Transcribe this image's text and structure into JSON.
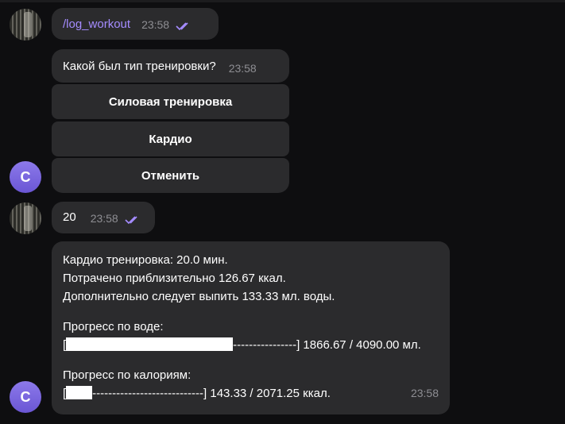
{
  "messages": {
    "m1": {
      "text": "/log_workout",
      "time": "23:58"
    },
    "m2": {
      "text": "Какой был тип тренировки?",
      "time": "23:58"
    },
    "keyboard": {
      "b1": "Силовая тренировка",
      "b2": "Кардио",
      "b3": "Отменить"
    },
    "m3": {
      "text": "20",
      "time": "23:58"
    },
    "m4": {
      "line1": "Кардио тренировка: 20.0 мин.",
      "line2": "Потрачено приблизительно 126.67 ккал.",
      "line3": "Дополнительно следует выпить 133.33 мл. воды.",
      "water_title": "Прогресс по воде:",
      "water_open": "[",
      "water_dashes": "----------------]",
      "water_value": " 1866.67 / 4090.00 мл.",
      "cal_title": "Прогресс по калориям:",
      "cal_open": "[",
      "cal_dashes": "----------------------------]",
      "cal_value": " 143.33 / 2071.25 ккал.",
      "time": "23:58"
    }
  },
  "avatars": {
    "bot_letter": "C"
  },
  "colors": {
    "background": "#0e0e10",
    "bubble": "#2b2b2d",
    "accent": "#a58cff",
    "avatar": "#7a66e0"
  },
  "progress": {
    "water_fraction": 0.456,
    "calorie_fraction": 0.069
  }
}
